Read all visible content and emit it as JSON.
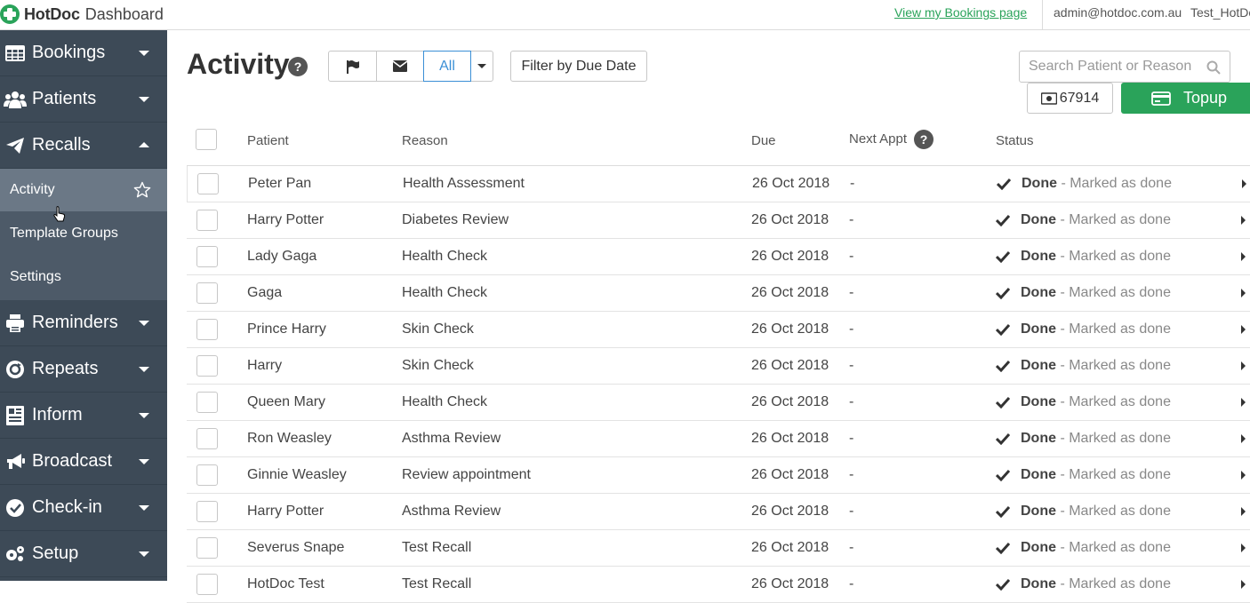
{
  "topbar": {
    "brand_name": "HotDoc",
    "brand_sub": "Dashboard",
    "bookings_link": "View my Bookings page",
    "user_email": "admin@hotdoc.com.au",
    "org_name": "Test_HotDoc"
  },
  "sidebar": {
    "items": [
      {
        "label": "Bookings",
        "icon": "calendar-grid-icon"
      },
      {
        "label": "Patients",
        "icon": "users-icon"
      },
      {
        "label": "Recalls",
        "icon": "paper-plane-icon"
      },
      {
        "label": "Reminders",
        "icon": "printer-icon"
      },
      {
        "label": "Repeats",
        "icon": "refresh-icon"
      },
      {
        "label": "Inform",
        "icon": "newspaper-icon"
      },
      {
        "label": "Broadcast",
        "icon": "megaphone-icon"
      },
      {
        "label": "Check-in",
        "icon": "check-circle-icon"
      },
      {
        "label": "Setup",
        "icon": "gears-icon"
      }
    ],
    "sub_items": [
      {
        "label": "Activity"
      },
      {
        "label": "Template Groups"
      },
      {
        "label": "Settings"
      }
    ]
  },
  "main": {
    "title": "Activity",
    "filter_all": "All",
    "filter_due": "Filter by Due Date",
    "search_placeholder": "Search Patient or Reason",
    "credit": "67914",
    "topup": "Topup"
  },
  "table": {
    "headers": {
      "patient": "Patient",
      "reason": "Reason",
      "due": "Due",
      "next_appt": "Next Appt",
      "status": "Status"
    },
    "rows": [
      {
        "patient": "Peter Pan",
        "reason": "Health Assessment",
        "due": "26 Oct 2018",
        "next": "-",
        "status": "Done",
        "note": "- Marked as done"
      },
      {
        "patient": "Harry Potter",
        "reason": "Diabetes Review",
        "due": "26 Oct 2018",
        "next": "-",
        "status": "Done",
        "note": "- Marked as done"
      },
      {
        "patient": "Lady Gaga",
        "reason": "Health Check",
        "due": "26 Oct 2018",
        "next": "-",
        "status": "Done",
        "note": "- Marked as done"
      },
      {
        "patient": "Gaga",
        "reason": "Health Check",
        "due": "26 Oct 2018",
        "next": "-",
        "status": "Done",
        "note": "- Marked as done"
      },
      {
        "patient": "Prince Harry",
        "reason": "Skin Check",
        "due": "26 Oct 2018",
        "next": "-",
        "status": "Done",
        "note": "- Marked as done"
      },
      {
        "patient": "Harry",
        "reason": "Skin Check",
        "due": "26 Oct 2018",
        "next": "-",
        "status": "Done",
        "note": "- Marked as done"
      },
      {
        "patient": "Queen Mary",
        "reason": "Health Check",
        "due": "26 Oct 2018",
        "next": "-",
        "status": "Done",
        "note": "- Marked as done"
      },
      {
        "patient": "Ron Weasley",
        "reason": "Asthma Review",
        "due": "26 Oct 2018",
        "next": "-",
        "status": "Done",
        "note": "- Marked as done"
      },
      {
        "patient": "Ginnie Weasley",
        "reason": "Review appointment",
        "due": "26 Oct 2018",
        "next": "-",
        "status": "Done",
        "note": "- Marked as done"
      },
      {
        "patient": "Harry Potter",
        "reason": "Asthma Review",
        "due": "26 Oct 2018",
        "next": "-",
        "status": "Done",
        "note": "- Marked as done"
      },
      {
        "patient": "Severus Snape",
        "reason": "Test Recall",
        "due": "26 Oct 2018",
        "next": "-",
        "status": "Done",
        "note": "- Marked as done"
      },
      {
        "patient": "HotDoc Test",
        "reason": "Test Recall",
        "due": "26 Oct 2018",
        "next": "-",
        "status": "Done",
        "note": "- Marked as done"
      }
    ]
  },
  "colors": {
    "sidebar": "#3d4a57",
    "sidebar_sub": "#4d5a68",
    "sidebar_active": "#6b7886",
    "accent_green": "#2aa35a",
    "accent_blue": "#3b8fd6"
  }
}
